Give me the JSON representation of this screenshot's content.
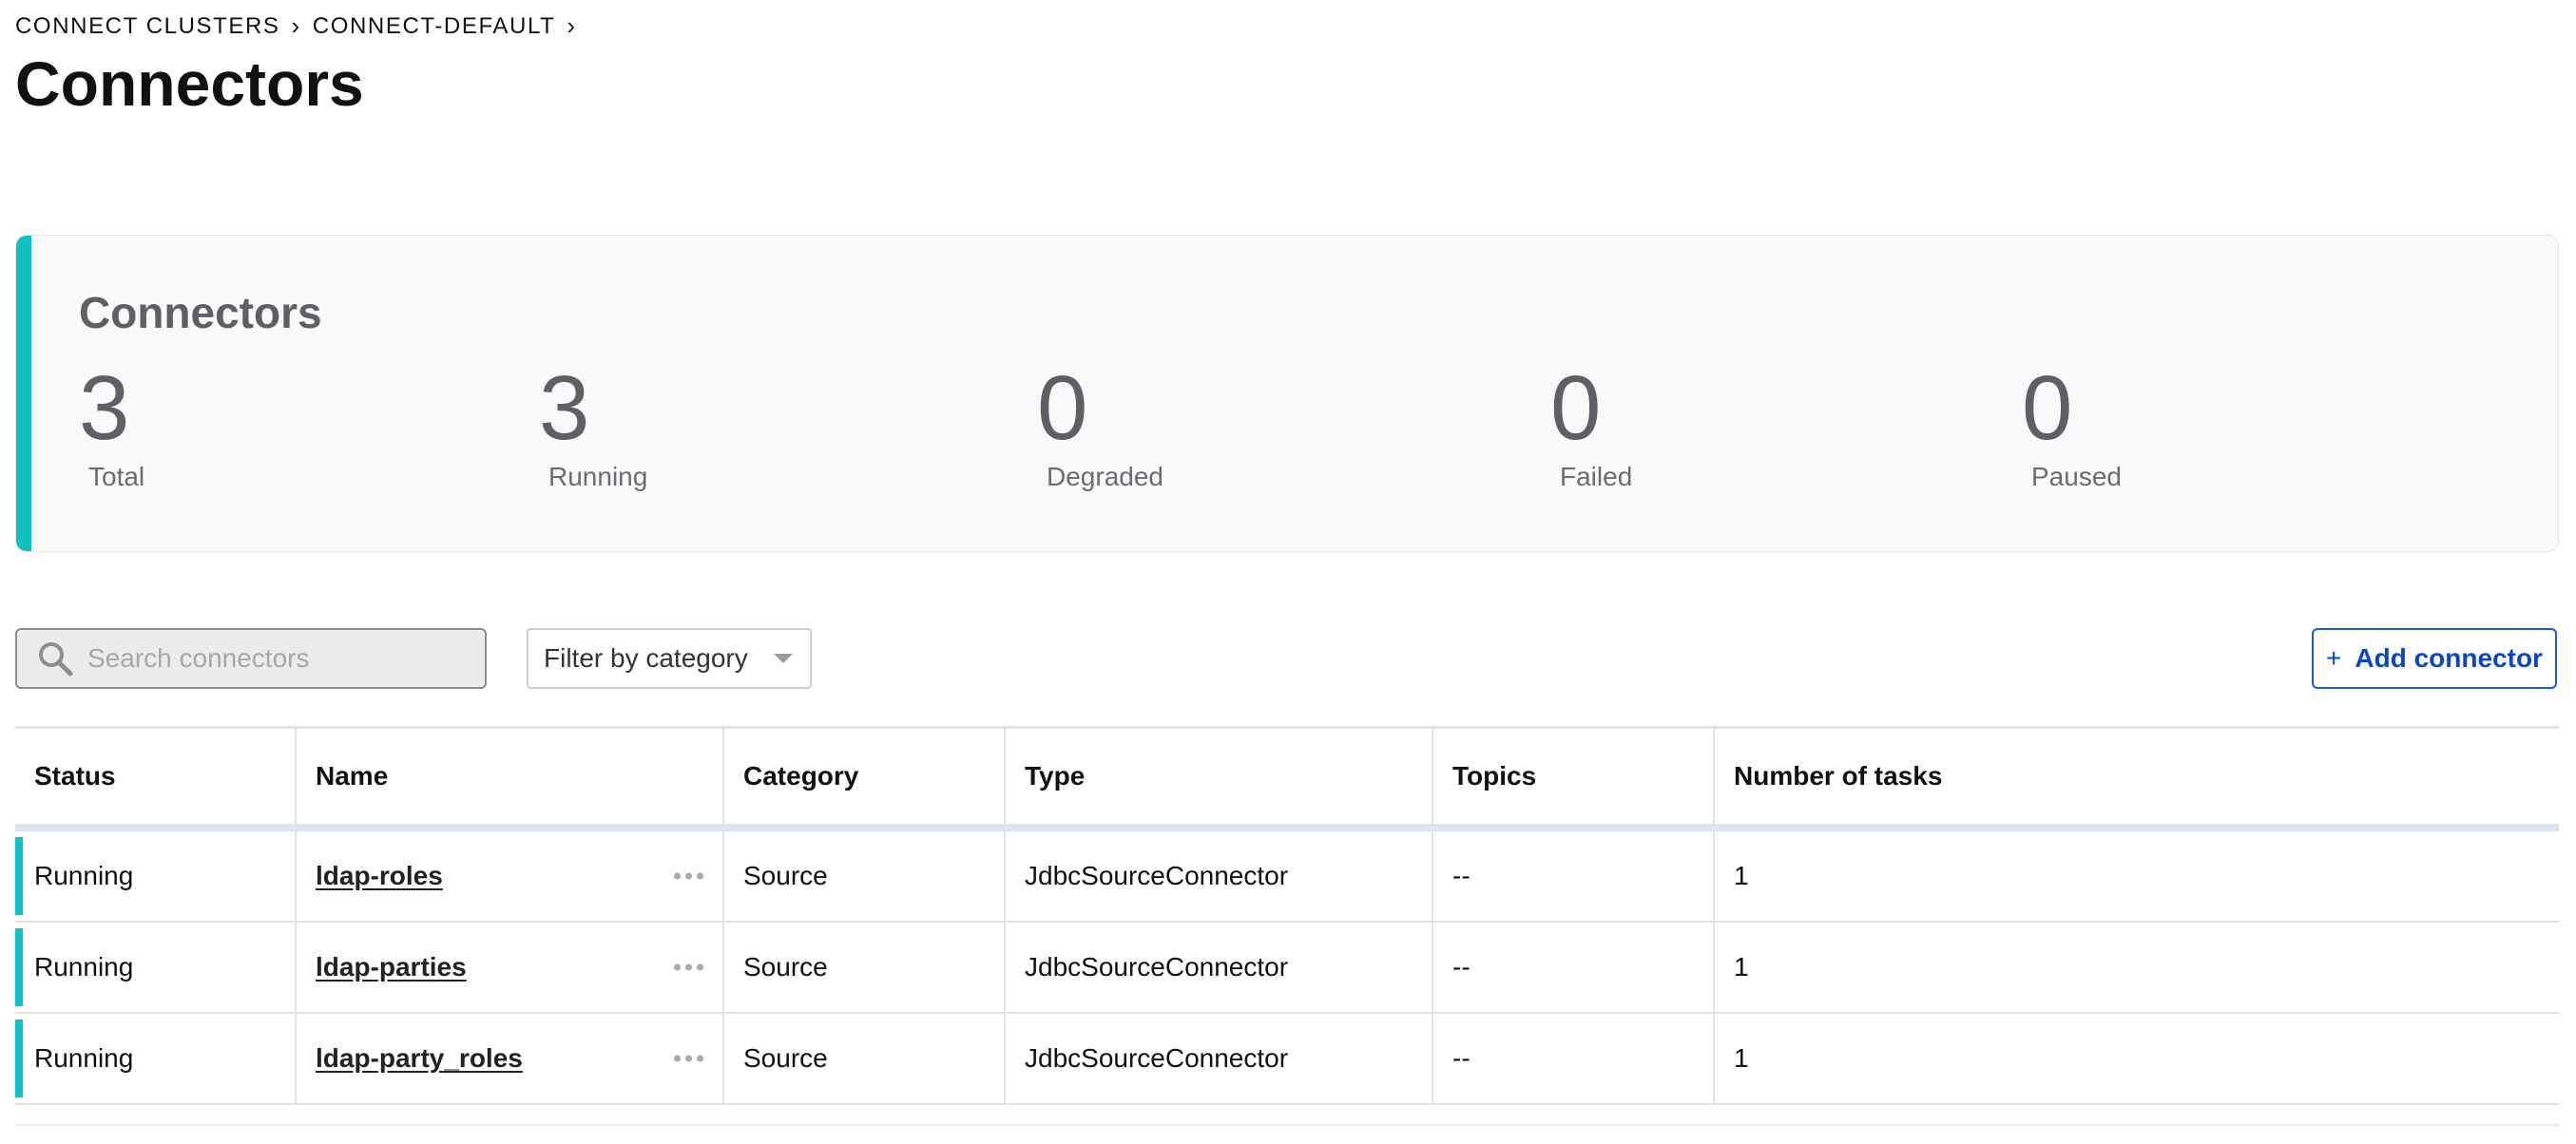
{
  "breadcrumb": {
    "items": [
      "CONNECT CLUSTERS",
      "CONNECT-DEFAULT"
    ],
    "separator": "›"
  },
  "page_title": "Connectors",
  "summary": {
    "title": "Connectors",
    "accent_color": "#10c0c3",
    "stats": [
      {
        "value": "3",
        "label": "Total"
      },
      {
        "value": "3",
        "label": "Running"
      },
      {
        "value": "0",
        "label": "Degraded"
      },
      {
        "value": "0",
        "label": "Failed"
      },
      {
        "value": "0",
        "label": "Paused"
      }
    ]
  },
  "toolbar": {
    "search_placeholder": "Search connectors",
    "search_icon": "magnifier",
    "filter_label": "Filter by category",
    "add_label": "Add connector",
    "add_icon": "+",
    "add_color": "#0b47c2"
  },
  "table": {
    "columns": [
      "Status",
      "Name",
      "Category",
      "Type",
      "Topics",
      "Number of tasks"
    ],
    "rows": [
      {
        "status": "Running",
        "name": "ldap-roles",
        "category": "Source",
        "type": "JdbcSourceConnector",
        "topics": "--",
        "tasks": "1"
      },
      {
        "status": "Running",
        "name": "ldap-parties",
        "category": "Source",
        "type": "JdbcSourceConnector",
        "topics": "--",
        "tasks": "1"
      },
      {
        "status": "Running",
        "name": "ldap-party_roles",
        "category": "Source",
        "type": "JdbcSourceConnector",
        "topics": "--",
        "tasks": "1"
      }
    ],
    "status_color": "#10c0c3"
  }
}
